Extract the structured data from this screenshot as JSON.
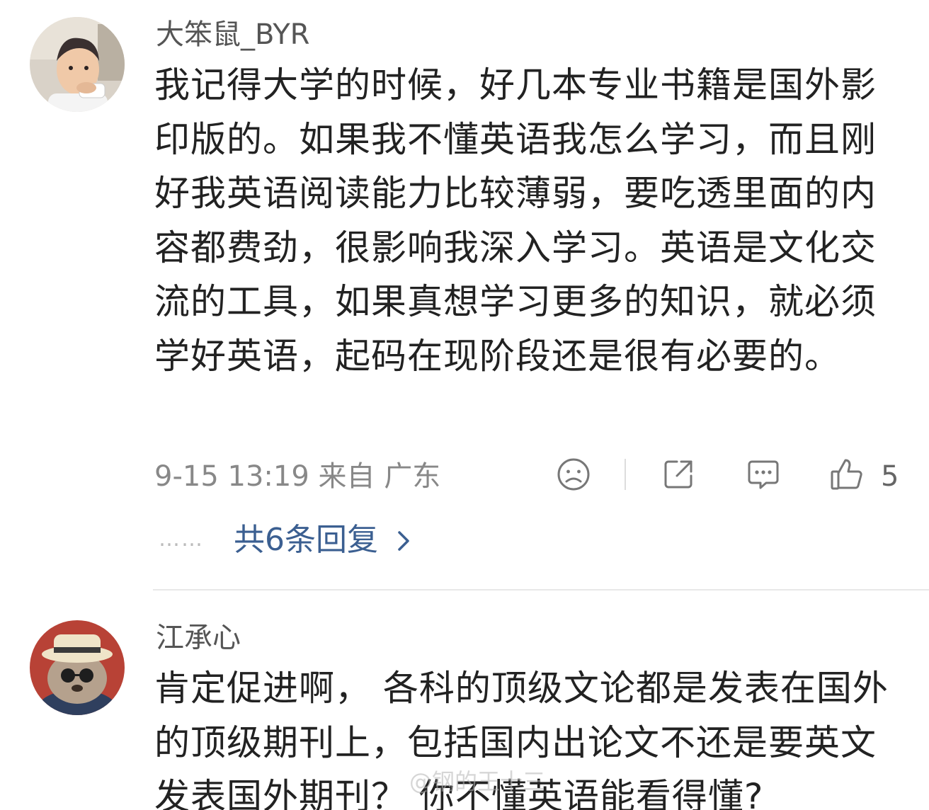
{
  "comments": [
    {
      "username": "大笨鼠_BYR",
      "text": "我记得大学的时候，好几本专业书籍是国外影印版的。如果我不懂英语我怎么学习，而且刚好我英语阅读能力比较薄弱，要吃透里面的内容都费劲，很影响我深入学习。英语是文化交流的工具，如果真想学习更多的知识，就必须学好英语，起码在现阶段还是很有必要的。",
      "meta": "9-15 13:19 来自 广东",
      "like_count": "5",
      "replies_dots": "……",
      "replies_label": "共6条回复",
      "icons": [
        "sad-face-icon",
        "share-icon",
        "comment-icon",
        "thumbs-up-icon",
        "chevron-right-icon"
      ]
    },
    {
      "username": "江承心",
      "text": "肯定促进啊， 各科的顶级文论都是发表在国外的顶级期刊上，包括国内出论文不还是要英文发表国外期刊？ 你不懂英语能看得懂?"
    }
  ],
  "watermark": "@钢的王十三",
  "colors": {
    "username": "#555555",
    "body_text": "#222222",
    "meta": "#888888",
    "link": "#3b5f91",
    "divider": "#e8e8e8"
  }
}
